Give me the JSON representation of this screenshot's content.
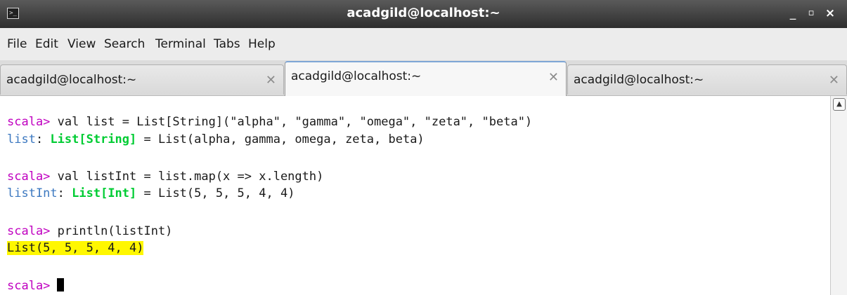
{
  "window": {
    "title": "acadgild@localhost:~",
    "controls": {
      "minimize": "_",
      "maximize": "▫",
      "close": "×"
    },
    "icon": "terminal-icon"
  },
  "menu": {
    "items": [
      "File",
      "Edit",
      "View",
      "Search",
      "Terminal",
      "Tabs",
      "Help"
    ]
  },
  "tabs": [
    {
      "label": "acadgild@localhost:~",
      "active": false,
      "close": "✕"
    },
    {
      "label": "acadgild@localhost:~",
      "active": true,
      "close": "✕"
    },
    {
      "label": "acadgild@localhost:~",
      "active": false,
      "close": "✕"
    }
  ],
  "terminal": {
    "prompt": "scala>",
    "line1_cmd": " val list = List[String](\"alpha\", \"gamma\", \"omega\", \"zeta\", \"beta\")",
    "line2_name": "list",
    "line2_colon": ": ",
    "line2_type": "List[String]",
    "line2_value": " = List(alpha, gamma, omega, zeta, beta)",
    "line4_cmd": " val listInt = list.map(x => x.length)",
    "line5_name": "listInt",
    "line5_colon": ": ",
    "line5_type": "List[Int]",
    "line5_value": " = List(5, 5, 5, 4, 4)",
    "line7_cmd": " println(listInt)",
    "line8_output": "List(5, 5, 5, 4, 4)"
  },
  "colors": {
    "prompt": "#c000c0",
    "identifier": "#3c78c0",
    "type": "#00cc33",
    "highlight": "#fff700",
    "titlebar": "#3a3a3a"
  }
}
